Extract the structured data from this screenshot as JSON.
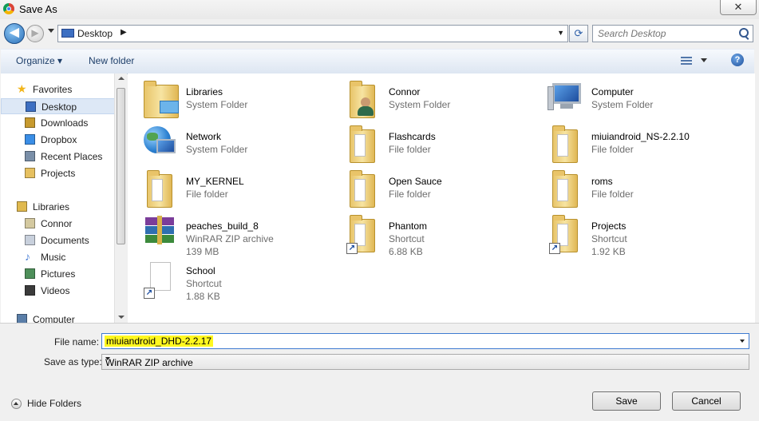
{
  "window": {
    "title": "Save As",
    "close_glyph": "✕"
  },
  "nav": {
    "back_glyph": "◀",
    "forward_glyph": "▶"
  },
  "address": {
    "location": "Desktop",
    "separator": "▶",
    "dropdown": "▼",
    "refresh_glyph": "⟳"
  },
  "search": {
    "placeholder": "Search Desktop"
  },
  "toolbar": {
    "organize": "Organize ▾",
    "new_folder": "New folder",
    "help": "?"
  },
  "navpane": {
    "items": [
      {
        "label": "Favorites",
        "icon": "star-icon",
        "level": 0
      },
      {
        "label": "Desktop",
        "icon": "desktop-icon",
        "level": 1,
        "selected": true
      },
      {
        "label": "Downloads",
        "icon": "downloads-icon",
        "level": 1
      },
      {
        "label": "Dropbox",
        "icon": "dropbox-icon",
        "level": 1
      },
      {
        "label": "Recent Places",
        "icon": "recent-places-icon",
        "level": 1
      },
      {
        "label": "Projects",
        "icon": "folder-icon",
        "level": 1
      },
      {
        "label": "Libraries",
        "icon": "libraries-icon",
        "level": 0
      },
      {
        "label": "Connor",
        "icon": "library-icon",
        "level": 1
      },
      {
        "label": "Documents",
        "icon": "documents-icon",
        "level": 1
      },
      {
        "label": "Music",
        "icon": "music-icon",
        "level": 1
      },
      {
        "label": "Pictures",
        "icon": "pictures-icon",
        "level": 1
      },
      {
        "label": "Videos",
        "icon": "videos-icon",
        "level": 1
      },
      {
        "label": "Computer",
        "icon": "computer-icon",
        "level": 0
      }
    ]
  },
  "files": [
    {
      "name": "Libraries",
      "type": "System Folder",
      "size": "",
      "icon": "libraries-icon"
    },
    {
      "name": "Connor",
      "type": "System Folder",
      "size": "",
      "icon": "user-folder-icon"
    },
    {
      "name": "Computer",
      "type": "System Folder",
      "size": "",
      "icon": "computer-icon"
    },
    {
      "name": "Network",
      "type": "System Folder",
      "size": "",
      "icon": "network-icon"
    },
    {
      "name": "Flashcards",
      "type": "File folder",
      "size": "",
      "icon": "folder-icon"
    },
    {
      "name": "miuiandroid_NS-2.2.10",
      "type": "File folder",
      "size": "",
      "icon": "folder-icon"
    },
    {
      "name": "MY_KERNEL",
      "type": "File folder",
      "size": "",
      "icon": "folder-icon"
    },
    {
      "name": "Open Sauce",
      "type": "File folder",
      "size": "",
      "icon": "folder-icon"
    },
    {
      "name": "roms",
      "type": "File folder",
      "size": "",
      "icon": "folder-icon"
    },
    {
      "name": "peaches_build_8",
      "type": "WinRAR ZIP archive",
      "size": "139 MB",
      "icon": "winrar-icon"
    },
    {
      "name": "Phantom",
      "type": "Shortcut",
      "size": "6.88 KB",
      "icon": "shortcut-folder-icon"
    },
    {
      "name": "Projects",
      "type": "Shortcut",
      "size": "1.92 KB",
      "icon": "shortcut-folder-icon"
    },
    {
      "name": "School",
      "type": "Shortcut",
      "size": "1.88 KB",
      "icon": "shortcut-file-icon"
    }
  ],
  "form": {
    "file_name_label": "File name:",
    "file_name_value": "miuiandroid_DHD-2.2.17",
    "save_type_label": "Save as type:",
    "save_type_value": "WinRAR ZIP archive"
  },
  "footer": {
    "hide_folders": "Hide Folders",
    "save": "Save",
    "cancel": "Cancel"
  },
  "colors": {
    "highlight": "#fff820",
    "selection": "#dde8f6",
    "accent": "#3e7bd1"
  }
}
